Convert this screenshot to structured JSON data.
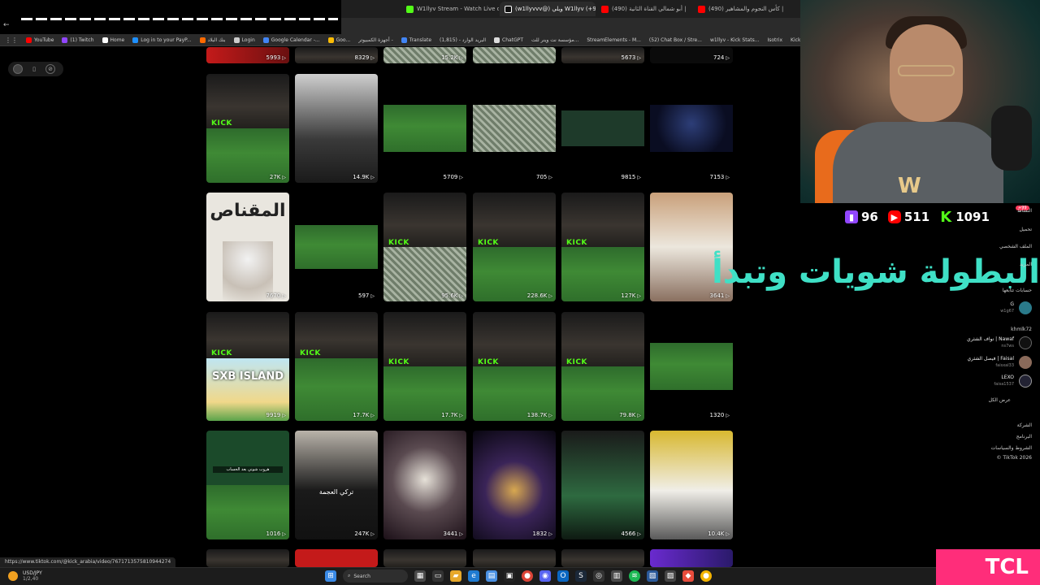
{
  "browser": {
    "tabs": [
      {
        "label": "W1llyv Stream - Watch Live on",
        "color": "#53fc18"
      },
      {
        "label": "(w1llyvvv@) ويلي W1llyv (+99)",
        "color": "#ffffff",
        "active": true
      },
      {
        "label": "(490) أبو شمالي القناة الثانية |",
        "color": "#ff0000"
      },
      {
        "label": "(490) كأس النجوم والمشاهير |",
        "color": "#ff0000"
      }
    ],
    "bookmarks": [
      {
        "label": "YouTube",
        "color": "#ff0000"
      },
      {
        "label": "(1) Twitch",
        "color": "#9146ff"
      },
      {
        "label": "Home",
        "color": "#ffffff"
      },
      {
        "label": "Log in to your PayP...",
        "color": "#1e90ff"
      },
      {
        "label": "بنك البلاد",
        "color": "#ff6a00"
      },
      {
        "label": "Login",
        "color": "#cccccc"
      },
      {
        "label": "Google Calendar -...",
        "color": "#4285f4"
      },
      {
        "label": "Goo...",
        "color": "#fbbc05"
      },
      {
        "label": "أجهزة الكمبيوتر -",
        "color": "#cccccc"
      },
      {
        "label": "Translate",
        "color": "#4285f4"
      },
      {
        "label": "البريد الوارد - (1,815)",
        "color": "#ea4335"
      },
      {
        "label": "ChatGPT",
        "color": "#dddddd"
      },
      {
        "label": "مؤسسة نت وينر للت...",
        "color": "#cccccc"
      },
      {
        "label": "StreamElements - M...",
        "color": "#dddddd"
      },
      {
        "label": "(52) Chat Box / Stre...",
        "color": "#3fa9f5"
      },
      {
        "label": "w1llyv - Kick Stats...",
        "color": "#53fc18"
      },
      {
        "label": "Isotrix",
        "color": "#cccccc"
      },
      {
        "label": "Kick",
        "color": "#53fc18"
      }
    ]
  },
  "grid": {
    "top_row": [
      "5993",
      "8329",
      "15.2K",
      "",
      "5673",
      "724"
    ],
    "row1": [
      {
        "views": "27K",
        "kick": true
      },
      {
        "views": "14.9K"
      },
      {
        "views": "5709"
      },
      {
        "views": "705"
      },
      {
        "views": "9815"
      },
      {
        "views": "7153"
      }
    ],
    "row2": [
      {
        "views": "7670",
        "title": "المقناص"
      },
      {
        "views": "597"
      },
      {
        "views": "95.6K",
        "kick": true
      },
      {
        "views": "228.6K",
        "kick": true
      },
      {
        "views": "127K",
        "kick": true
      },
      {
        "views": "3641"
      }
    ],
    "row3": [
      {
        "views": "9919",
        "title": "SXB ISLAND",
        "kick": true
      },
      {
        "views": "17.7K",
        "kick": true
      },
      {
        "views": "17.7K",
        "kick": true
      },
      {
        "views": "138.7K",
        "kick": true
      },
      {
        "views": "79.8K",
        "kick": true
      },
      {
        "views": "1320"
      }
    ],
    "row4": [
      {
        "views": "1016",
        "caption": "هروب شوني بعد الحساب"
      },
      {
        "views": "247K",
        "caption": "تركي العجمة"
      },
      {
        "views": "3441"
      },
      {
        "views": "1832"
      },
      {
        "views": "4566"
      },
      {
        "views": "10.4K"
      }
    ]
  },
  "overlay": {
    "twitch_viewers": "96",
    "youtube_viewers": "511",
    "kick_viewers": "1091",
    "caption": "البطولة شويات وتبدأ"
  },
  "sidebar": {
    "live_badge": "+99",
    "items": [
      "النشاط",
      "تحميل",
      "الملف الشخصي",
      "المزيد"
    ],
    "following_label": "حسابات تتابعها",
    "accounts": [
      {
        "name": "G",
        "user": "w1g67"
      },
      {
        "name": "",
        "user": "khmlk72"
      },
      {
        "name": "Nawaf | نواف الشثري",
        "user": "ns7ws"
      },
      {
        "name": "Faisal | فيصل الشثري",
        "user": "faisxal33"
      },
      {
        "name": "LEXO",
        "user": "faisa1537"
      }
    ],
    "see_all": "عرض الكل",
    "footer": [
      "الشركة",
      "البرنامج",
      "الشروط والسياسات",
      "TikTok 2026 ©"
    ]
  },
  "status": {
    "url": "https://www.tiktok.com/@kick_arabia/video/7671713575810944274"
  },
  "taskbar": {
    "ticker": "USD/JPY",
    "ticker_change": "1/2,40",
    "search_placeholder": "Search"
  },
  "brand": "TCL"
}
